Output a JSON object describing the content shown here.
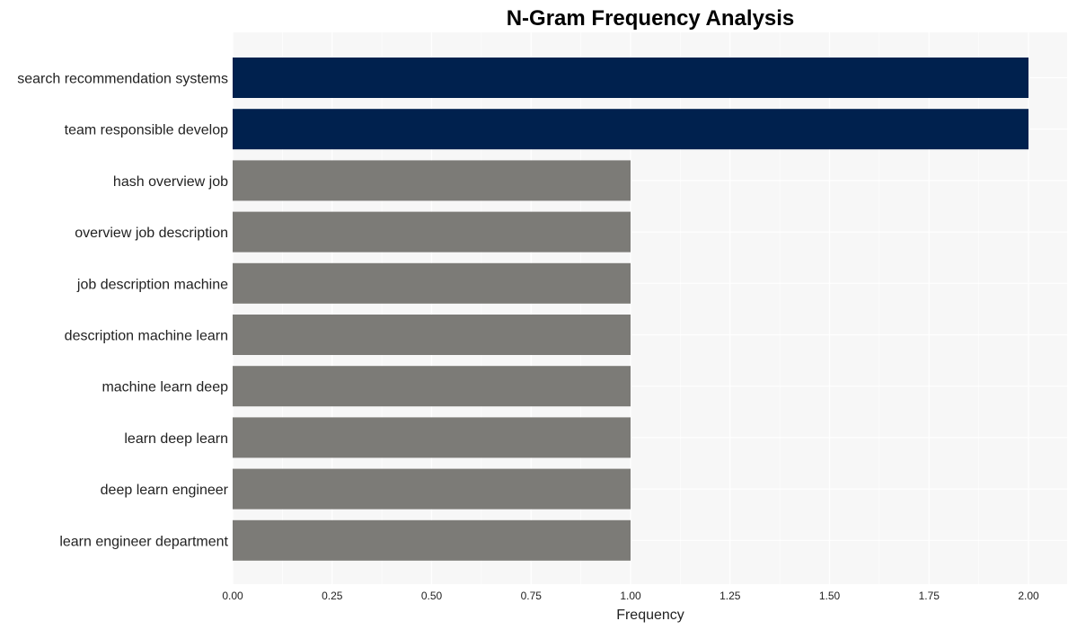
{
  "chart_data": {
    "type": "bar",
    "orientation": "horizontal",
    "title": "N-Gram Frequency Analysis",
    "xlabel": "Frequency",
    "ylabel": "",
    "categories": [
      "search recommendation systems",
      "team responsible develop",
      "hash overview job",
      "overview job description",
      "job description machine",
      "description machine learn",
      "machine learn deep",
      "learn deep learn",
      "deep learn engineer",
      "learn engineer department"
    ],
    "values": [
      2,
      2,
      1,
      1,
      1,
      1,
      1,
      1,
      1,
      1
    ],
    "bar_colors": [
      "#00214e",
      "#00214e",
      "#7c7b77",
      "#7c7b77",
      "#7c7b77",
      "#7c7b77",
      "#7c7b77",
      "#7c7b77",
      "#7c7b77",
      "#7c7b77"
    ],
    "xlim": [
      0,
      2.1
    ],
    "xticks": [
      0,
      0.25,
      0.5,
      0.75,
      1.0,
      1.25,
      1.5,
      1.75,
      2.0
    ],
    "xtick_labels": [
      "0.00",
      "0.25",
      "0.50",
      "0.75",
      "1.00",
      "1.25",
      "1.50",
      "1.75",
      "2.00"
    ],
    "grid": true,
    "legend": "none",
    "background": "#f7f7f7",
    "grid_color": "#ffffff"
  }
}
